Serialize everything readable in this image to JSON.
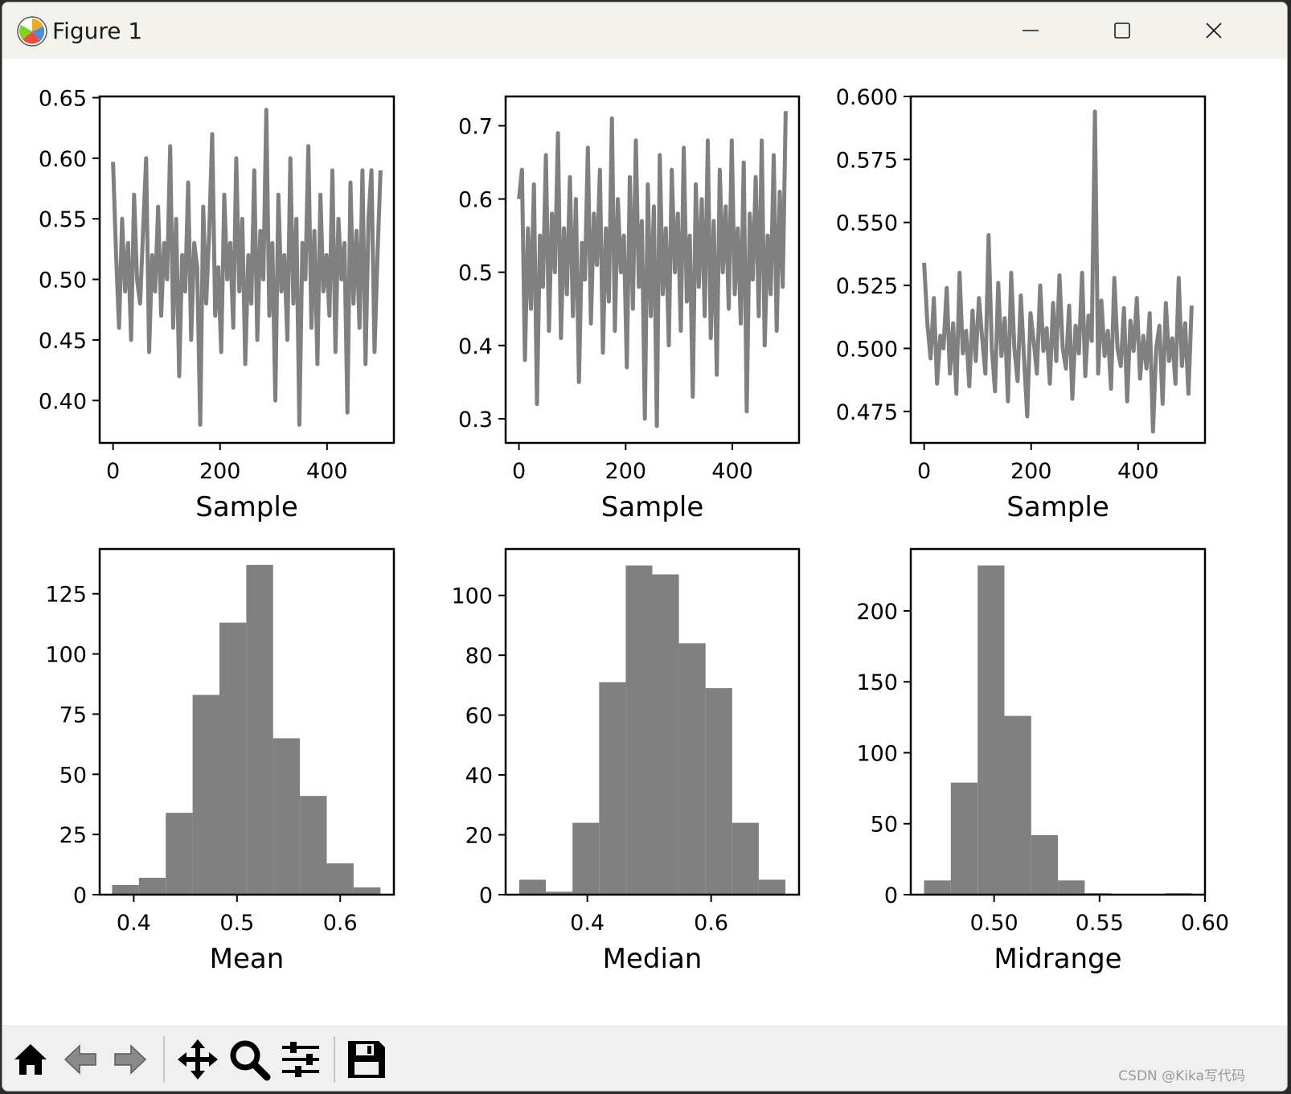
{
  "window": {
    "title": "Figure 1",
    "controls": {
      "minimize": "minimize",
      "maximize": "maximize",
      "close": "close"
    }
  },
  "toolbar": {
    "buttons": [
      "home-icon",
      "back-icon",
      "forward-icon",
      "pan-icon",
      "zoom-icon",
      "configure-subplots-icon",
      "save-icon"
    ]
  },
  "watermark": "CSDN @Kika写代码",
  "colors": {
    "series": "#808080",
    "axes": "#000000",
    "titlebar": "#f3f2ec",
    "toolbar": "#f0f0f0"
  },
  "chart_data": [
    {
      "type": "line",
      "xlabel": "Sample",
      "ylabel": "",
      "xlim": [
        -25,
        525
      ],
      "ylim": [
        0.365,
        0.651
      ],
      "xticks": [
        0,
        200,
        400
      ],
      "xticklabels": [
        "0",
        "200",
        "400"
      ],
      "yticks": [
        0.4,
        0.45,
        0.5,
        0.55,
        0.6,
        0.65
      ],
      "yticklabels": [
        "0.40",
        "0.45",
        "0.50",
        "0.55",
        "0.60",
        "0.65"
      ],
      "grid": false,
      "series": [
        {
          "x_range": [
            0,
            500
          ],
          "y_range": [
            0.38,
            0.64
          ],
          "center": 0.51,
          "y": [
            0.597,
            0.52,
            0.46,
            0.55,
            0.49,
            0.53,
            0.45,
            0.57,
            0.5,
            0.48,
            0.54,
            0.6,
            0.44,
            0.52,
            0.49,
            0.56,
            0.47,
            0.53,
            0.5,
            0.61,
            0.46,
            0.55,
            0.42,
            0.52,
            0.49,
            0.58,
            0.45,
            0.53,
            0.51,
            0.38,
            0.56,
            0.48,
            0.54,
            0.62,
            0.47,
            0.51,
            0.44,
            0.57,
            0.5,
            0.53,
            0.46,
            0.6,
            0.49,
            0.55,
            0.43,
            0.52,
            0.48,
            0.59,
            0.45,
            0.54,
            0.5,
            0.64,
            0.47,
            0.53,
            0.4,
            0.57,
            0.49,
            0.52,
            0.45,
            0.6,
            0.48,
            0.55,
            0.38,
            0.53,
            0.5,
            0.61,
            0.46,
            0.54,
            0.43,
            0.57,
            0.49,
            0.52,
            0.47,
            0.59,
            0.44,
            0.55,
            0.5,
            0.53,
            0.39,
            0.58,
            0.48,
            0.54,
            0.46,
            0.59,
            0.43,
            0.55,
            0.59,
            0.44,
            0.52,
            0.59
          ]
        }
      ]
    },
    {
      "type": "line",
      "xlabel": "Sample",
      "ylabel": "",
      "xlim": [
        -25,
        525
      ],
      "ylim": [
        0.267,
        0.74
      ],
      "xticks": [
        0,
        200,
        400
      ],
      "xticklabels": [
        "0",
        "200",
        "400"
      ],
      "yticks": [
        0.3,
        0.4,
        0.5,
        0.6,
        0.7
      ],
      "yticklabels": [
        "0.3",
        "0.4",
        "0.5",
        "0.6",
        "0.7"
      ],
      "grid": false,
      "series": [
        {
          "x_range": [
            0,
            500
          ],
          "y_range": [
            0.29,
            0.72
          ],
          "center": 0.51,
          "y": [
            0.6,
            0.64,
            0.38,
            0.56,
            0.45,
            0.62,
            0.32,
            0.55,
            0.48,
            0.66,
            0.42,
            0.58,
            0.5,
            0.69,
            0.41,
            0.56,
            0.47,
            0.63,
            0.44,
            0.6,
            0.35,
            0.54,
            0.49,
            0.67,
            0.43,
            0.58,
            0.51,
            0.64,
            0.39,
            0.56,
            0.46,
            0.71,
            0.42,
            0.6,
            0.5,
            0.55,
            0.37,
            0.63,
            0.45,
            0.68,
            0.48,
            0.57,
            0.3,
            0.62,
            0.44,
            0.59,
            0.29,
            0.66,
            0.47,
            0.56,
            0.4,
            0.64,
            0.5,
            0.58,
            0.42,
            0.67,
            0.46,
            0.55,
            0.33,
            0.62,
            0.48,
            0.6,
            0.44,
            0.68,
            0.41,
            0.57,
            0.36,
            0.64,
            0.5,
            0.59,
            0.45,
            0.68,
            0.47,
            0.56,
            0.43,
            0.65,
            0.31,
            0.58,
            0.49,
            0.63,
            0.44,
            0.68,
            0.4,
            0.55,
            0.47,
            0.66,
            0.42,
            0.61,
            0.48,
            0.72
          ]
        }
      ]
    },
    {
      "type": "line",
      "xlabel": "Sample",
      "ylabel": "",
      "xlim": [
        -25,
        525
      ],
      "ylim": [
        0.4625,
        0.6
      ],
      "xticks": [
        0,
        200,
        400
      ],
      "xticklabels": [
        "0",
        "200",
        "400"
      ],
      "yticks": [
        0.475,
        0.5,
        0.525,
        0.55,
        0.575,
        0.6
      ],
      "yticklabels": [
        "0.475",
        "0.500",
        "0.525",
        "0.550",
        "0.575",
        "0.600"
      ],
      "grid": false,
      "series": [
        {
          "x_range": [
            0,
            500
          ],
          "y_range": [
            0.467,
            0.594
          ],
          "center": 0.503,
          "y": [
            0.534,
            0.51,
            0.496,
            0.52,
            0.486,
            0.505,
            0.5,
            0.524,
            0.49,
            0.51,
            0.482,
            0.53,
            0.498,
            0.507,
            0.485,
            0.515,
            0.495,
            0.52,
            0.504,
            0.49,
            0.545,
            0.5,
            0.483,
            0.526,
            0.497,
            0.512,
            0.479,
            0.53,
            0.5,
            0.487,
            0.521,
            0.496,
            0.473,
            0.514,
            0.503,
            0.49,
            0.525,
            0.499,
            0.508,
            0.486,
            0.518,
            0.495,
            0.529,
            0.5,
            0.492,
            0.517,
            0.48,
            0.509,
            0.498,
            0.53,
            0.489,
            0.513,
            0.503,
            0.594,
            0.49,
            0.519,
            0.497,
            0.507,
            0.484,
            0.528,
            0.5,
            0.493,
            0.516,
            0.479,
            0.511,
            0.499,
            0.52,
            0.488,
            0.505,
            0.492,
            0.514,
            0.467,
            0.5,
            0.509,
            0.478,
            0.518,
            0.495,
            0.504,
            0.486,
            0.528,
            0.493,
            0.51,
            0.482,
            0.517
          ]
        }
      ]
    },
    {
      "type": "bar",
      "subtype": "histogram",
      "xlabel": "Mean",
      "ylabel": "",
      "xlim": [
        0.367,
        0.652
      ],
      "ylim": [
        0,
        143.6
      ],
      "bin_edges": [
        0.379,
        0.405,
        0.431,
        0.457,
        0.483,
        0.509,
        0.535,
        0.561,
        0.587,
        0.613,
        0.639
      ],
      "values": [
        4,
        7,
        34,
        83,
        113,
        137,
        65,
        41,
        13,
        3
      ],
      "xticks": [
        0.4,
        0.5,
        0.6
      ],
      "xticklabels": [
        "0.4",
        "0.5",
        "0.6"
      ],
      "yticks": [
        0,
        25,
        50,
        75,
        100,
        125
      ],
      "yticklabels": [
        "0",
        "25",
        "50",
        "75",
        "100",
        "125"
      ],
      "grid": false
    },
    {
      "type": "bar",
      "subtype": "histogram",
      "xlabel": "Median",
      "ylabel": "",
      "xlim": [
        0.268,
        0.742
      ],
      "ylim": [
        0,
        115.5
      ],
      "bin_edges": [
        0.29,
        0.333,
        0.376,
        0.419,
        0.462,
        0.505,
        0.548,
        0.591,
        0.634,
        0.677,
        0.72
      ],
      "values": [
        5,
        1,
        24,
        71,
        110,
        107,
        84,
        69,
        24,
        5
      ],
      "xticks": [
        0.4,
        0.6
      ],
      "xticklabels": [
        "0.4",
        "0.6"
      ],
      "yticks": [
        0,
        20,
        40,
        60,
        80,
        100
      ],
      "yticklabels": [
        "0",
        "20",
        "40",
        "60",
        "80",
        "100"
      ],
      "grid": false
    },
    {
      "type": "bar",
      "subtype": "histogram",
      "xlabel": "Midrange",
      "ylabel": "",
      "xlim": [
        0.4605,
        0.6
      ],
      "ylim": [
        0,
        243.6
      ],
      "bin_edges": [
        0.4668,
        0.4795,
        0.4922,
        0.5049,
        0.5176,
        0.5303,
        0.543,
        0.5557,
        0.5684,
        0.5811,
        0.5938
      ],
      "values": [
        10,
        79,
        232,
        126,
        42,
        10,
        1,
        0,
        0,
        1
      ],
      "xticks": [
        0.5,
        0.55,
        0.6
      ],
      "xticklabels": [
        "0.50",
        "0.55",
        "0.60"
      ],
      "yticks": [
        0,
        50,
        100,
        150,
        200
      ],
      "yticklabels": [
        "0",
        "50",
        "100",
        "150",
        "200"
      ],
      "grid": false
    }
  ]
}
